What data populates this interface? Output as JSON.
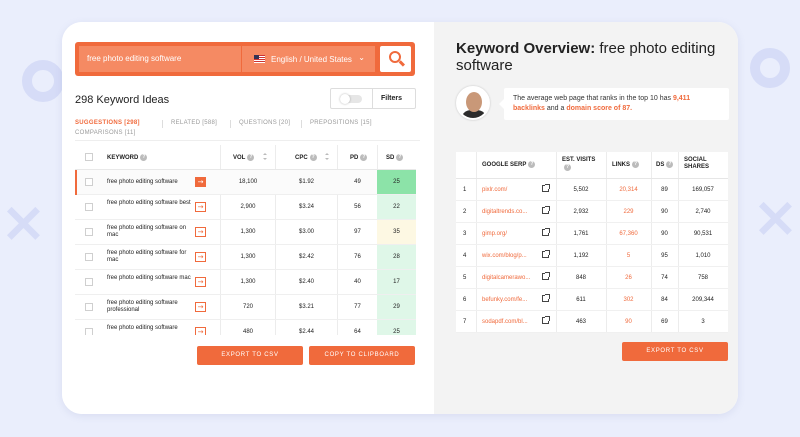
{
  "search": {
    "query": "free photo editing software",
    "language": "English / United States",
    "caret": "⌄"
  },
  "ideas": {
    "title": "298 Keyword Ideas",
    "filters_label": "Filters"
  },
  "tabs": [
    {
      "label": "SUGGESTIONS [298]",
      "active": true
    },
    {
      "label": "RELATED [588]",
      "active": false
    },
    {
      "label": "QUESTIONS [20]",
      "active": false
    },
    {
      "label": "PREPOSITIONS [15]",
      "active": false
    },
    {
      "label": "COMPARISONS [11]",
      "active": false
    }
  ],
  "keyword_table": {
    "columns": {
      "keyword": "KEYWORD",
      "vol": "VOL",
      "cpc": "CPC",
      "pd": "PD",
      "sd": "SD"
    },
    "rows": [
      {
        "keyword": "free photo editing software",
        "vol": "18,100",
        "cpc": "$1.92",
        "pd": "49",
        "sd": "25",
        "sd_color": "#8ce3a8"
      },
      {
        "keyword": "free photo editing software best",
        "vol": "2,900",
        "cpc": "$3.24",
        "pd": "56",
        "sd": "22",
        "sd_color": "#dff7e8"
      },
      {
        "keyword": "free photo editing software on mac",
        "vol": "1,300",
        "cpc": "$3.00",
        "pd": "97",
        "sd": "35",
        "sd_color": "#fdf8e3"
      },
      {
        "keyword": "free photo editing software for mac",
        "vol": "1,300",
        "cpc": "$2.42",
        "pd": "76",
        "sd": "28",
        "sd_color": "#dff7e8"
      },
      {
        "keyword": "free photo editing software mac",
        "vol": "1,300",
        "cpc": "$2.40",
        "pd": "40",
        "sd": "17",
        "sd_color": "#dff7e8"
      },
      {
        "keyword": "free photo editing software professional",
        "vol": "720",
        "cpc": "$3.21",
        "pd": "77",
        "sd": "29",
        "sd_color": "#dff7e8"
      },
      {
        "keyword": "free photo editing software",
        "vol": "480",
        "cpc": "$2.44",
        "pd": "64",
        "sd": "25",
        "sd_color": "#dff7e8"
      }
    ],
    "arrow_glyph": "→"
  },
  "buttons": {
    "export_csv": "EXPORT TO CSV",
    "copy_clipboard": "COPY TO CLIPBOARD",
    "export_csv_right": "EXPORT TO CSV"
  },
  "overview": {
    "title_bold": "Keyword Overview:",
    "title_rest": " free photo editing software",
    "bubble_prefix": "The average web page that ranks in the top 10 has ",
    "backlinks": "9,411 backlinks",
    "bubble_mid": " and a ",
    "domain_score": "domain score of 87."
  },
  "serp_table": {
    "columns": {
      "serp": "GOOGLE SERP",
      "visits": "EST. VISITS",
      "links": "LINKS",
      "ds": "DS",
      "shares": "SOCIAL SHARES"
    },
    "rows": [
      {
        "rank": "1",
        "url": "pixlr.com/",
        "visits": "5,502",
        "links": "20,314",
        "ds": "89",
        "shares": "169,057"
      },
      {
        "rank": "2",
        "url": "digitaltrends.co...",
        "visits": "2,932",
        "links": "229",
        "ds": "90",
        "shares": "2,740"
      },
      {
        "rank": "3",
        "url": "gimp.org/",
        "visits": "1,761",
        "links": "67,360",
        "ds": "90",
        "shares": "90,531"
      },
      {
        "rank": "4",
        "url": "wix.com/blog/p...",
        "visits": "1,192",
        "links": "5",
        "ds": "95",
        "shares": "1,010"
      },
      {
        "rank": "5",
        "url": "digitalcamerawo...",
        "visits": "848",
        "links": "26",
        "ds": "74",
        "shares": "758"
      },
      {
        "rank": "6",
        "url": "befunky.com/fe...",
        "visits": "611",
        "links": "302",
        "ds": "84",
        "shares": "209,344"
      },
      {
        "rank": "7",
        "url": "sodapdf.com/bl...",
        "visits": "463",
        "links": "90",
        "ds": "69",
        "shares": "3"
      }
    ]
  },
  "colors": {
    "accent": "#f06a3c",
    "background": "#eaeefc"
  }
}
